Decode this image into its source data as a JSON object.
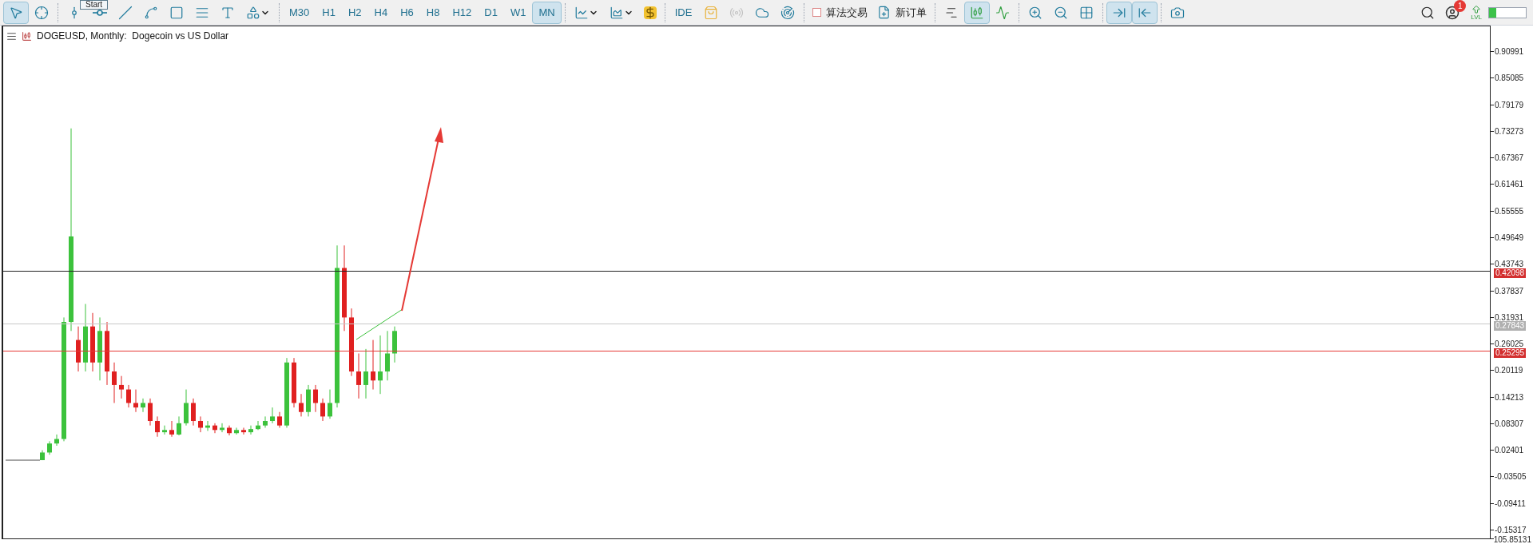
{
  "tooltip": {
    "text": "Start"
  },
  "drawing_tools": [
    {
      "selected": true
    },
    {
      "selected": false
    },
    {
      "selected": false
    },
    {
      "selected": false
    },
    {
      "selected": false
    },
    {
      "selected": false
    },
    {
      "selected": false
    },
    {
      "selected": false
    },
    {
      "selected": false
    },
    {
      "selected": false
    }
  ],
  "timeframes": [
    {
      "label": "M30",
      "selected": false
    },
    {
      "label": "H1",
      "selected": false
    },
    {
      "label": "H2",
      "selected": false
    },
    {
      "label": "H4",
      "selected": false
    },
    {
      "label": "H6",
      "selected": false
    },
    {
      "label": "H8",
      "selected": false
    },
    {
      "label": "H12",
      "selected": false
    },
    {
      "label": "D1",
      "selected": false
    },
    {
      "label": "W1",
      "selected": false
    },
    {
      "label": "MN",
      "selected": true
    }
  ],
  "ide_button": {
    "label": "IDE"
  },
  "algo_trading": {
    "label": "算法交易",
    "checked": false
  },
  "new_order": {
    "label": "新订单"
  },
  "chart_types": [
    {
      "selected": false
    },
    {
      "selected": true
    },
    {
      "selected": false
    }
  ],
  "view_toggles": [
    {
      "selected": true
    },
    {
      "selected": true
    }
  ],
  "notifications": {
    "badge": "1"
  },
  "level_meter": {
    "label": "LVL",
    "level": 0.2
  },
  "chart": {
    "title": "DOGEUSD, Monthly:  Dogecoin vs US Dollar",
    "price_labels": [
      "0.90991",
      "0.85085",
      "0.79179",
      "0.73273",
      "0.67367",
      "0.61461",
      "0.55555",
      "0.49649",
      "0.43743",
      "0.37837",
      "0.31931",
      "0.26025",
      "0.20119",
      "0.14213",
      "0.08307",
      "0.02401",
      "-0.03505",
      "-0.09411",
      "-0.15317"
    ],
    "level_lines": [
      {
        "price": "0.42098",
        "color": "#d32f2f"
      },
      {
        "price": "0.27843",
        "color": "#b0b0b0"
      },
      {
        "price": "0.25295",
        "color": "#d32f2f"
      }
    ],
    "bottom_label": "105.85131"
  }
}
